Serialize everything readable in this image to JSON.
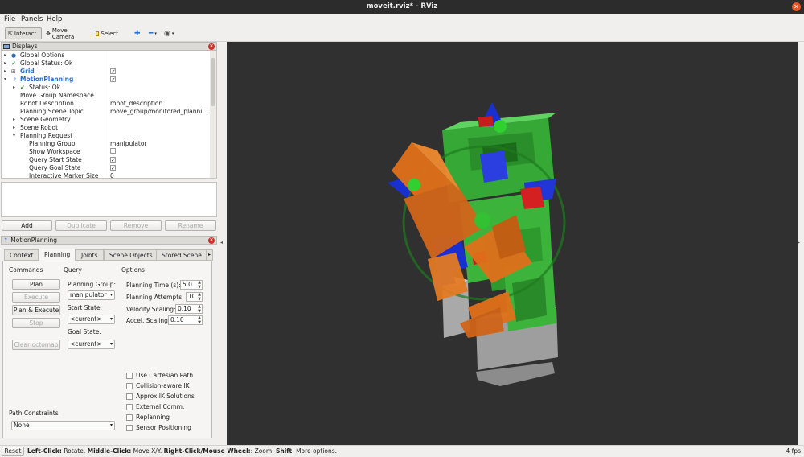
{
  "window": {
    "title": "moveit.rviz* - RViz",
    "close_glyph": "✕"
  },
  "menubar": {
    "file": "File",
    "panels": "Panels",
    "help": "Help"
  },
  "toolbar": {
    "interact": "Interact",
    "move_camera": "Move Camera",
    "select": "Select"
  },
  "displays": {
    "title": "Displays",
    "rows": [
      {
        "name": "Global Options",
        "value": ""
      },
      {
        "name": "Global Status: Ok",
        "value": ""
      },
      {
        "name": "Grid",
        "value": "✓"
      },
      {
        "name": "MotionPlanning",
        "value": "✓"
      },
      {
        "name": "Status: Ok",
        "value": ""
      },
      {
        "name": "Move Group Namespace",
        "value": ""
      },
      {
        "name": "Robot Description",
        "value": "robot_description"
      },
      {
        "name": "Planning Scene Topic",
        "value": "move_group/monitored_planni..."
      },
      {
        "name": "Scene Geometry",
        "value": ""
      },
      {
        "name": "Scene Robot",
        "value": ""
      },
      {
        "name": "Planning Request",
        "value": ""
      },
      {
        "name": "Planning Group",
        "value": "manipulator"
      },
      {
        "name": "Show Workspace",
        "value": ""
      },
      {
        "name": "Query Start State",
        "value": "✓"
      },
      {
        "name": "Query Goal State",
        "value": "✓"
      },
      {
        "name": "Interactive Marker Size",
        "value": "0"
      }
    ],
    "buttons": {
      "add": "Add",
      "duplicate": "Duplicate",
      "remove": "Remove",
      "rename": "Rename"
    }
  },
  "motion_planning": {
    "title": "MotionPlanning",
    "tabs": [
      "Context",
      "Planning",
      "Joints",
      "Scene Objects",
      "Stored Scene"
    ],
    "commands_label": "Commands",
    "buttons": {
      "plan": "Plan",
      "execute": "Execute",
      "plan_execute": "Plan & Execute",
      "stop": "Stop",
      "clear_octomap": "Clear octomap"
    },
    "query_label": "Query",
    "planning_group_label": "Planning Group:",
    "planning_group_value": "manipulator",
    "start_state_label": "Start State:",
    "start_state_value": "<current>",
    "goal_state_label": "Goal State:",
    "goal_state_value": "<current>",
    "options_label": "Options",
    "options": [
      {
        "label": "Planning Time (s):",
        "value": "5.0"
      },
      {
        "label": "Planning Attempts:",
        "value": "10"
      },
      {
        "label": "Velocity Scaling:",
        "value": "0.10"
      },
      {
        "label": "Accel. Scaling:",
        "value": "0.10"
      }
    ],
    "checkboxes": [
      "Use Cartesian Path",
      "Collision-aware IK",
      "Approx IK Solutions",
      "External Comm.",
      "Replanning",
      "Sensor Positioning"
    ],
    "path_constraints_label": "Path Constraints",
    "path_constraints_value": "None"
  },
  "statusbar": {
    "reset": "Reset",
    "left_click": "Left-Click:",
    "left_click_desc": " Rotate. ",
    "middle_click": "Middle-Click:",
    "middle_click_desc": " Move X/Y. ",
    "right_click": "Right-Click/Mouse Wheel:",
    "right_click_desc": ": Zoom. ",
    "shift": "Shift",
    "shift_desc": ": More options.",
    "fps": "4 fps"
  },
  "colors": {
    "accent": "#e95420",
    "viewport_bg": "#303030",
    "robot_green": "#3cb43c",
    "robot_orange": "#e0701a",
    "robot_blue": "#1a2fd0",
    "robot_gray": "#a8a8a8"
  }
}
